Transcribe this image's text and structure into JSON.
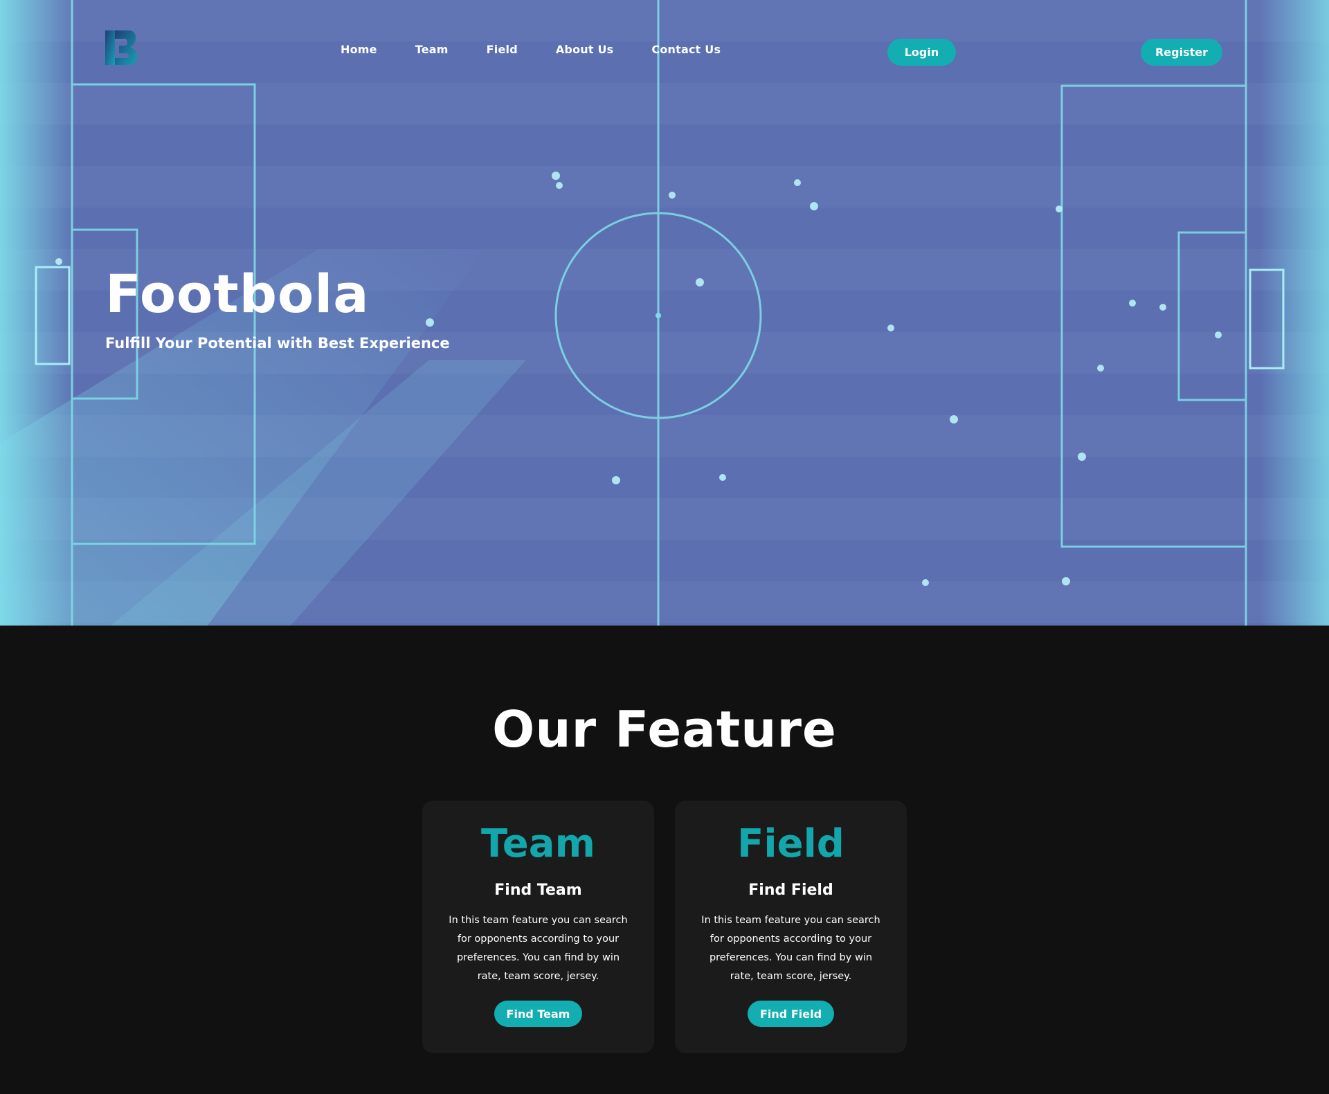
{
  "nav": {
    "items": [
      {
        "label": "Home"
      },
      {
        "label": "Team"
      },
      {
        "label": "Field"
      },
      {
        "label": "About Us"
      },
      {
        "label": "Contact Us"
      }
    ],
    "login_label": "Login",
    "register_label": "Register"
  },
  "hero": {
    "title": "Footbola",
    "subtitle": "Fulfill Your Potential with Best Experience"
  },
  "features": {
    "title": "Our Feature",
    "cards": [
      {
        "heading": "Team",
        "subheading": "Find Team",
        "description": "In this team feature you can search for opponents according to your preferences. You can find by win rate, team score, jersey.",
        "button_label": "Find Team"
      },
      {
        "heading": "Field",
        "subheading": "Find Field",
        "description": "In this team feature you can search for opponents according to your preferences. You can find by win rate, team score, jersey.",
        "button_label": "Find Field"
      }
    ]
  },
  "colors": {
    "accent": "#12aeb2",
    "card_heading": "#13a6ab",
    "hero_tint": "#5a73b1",
    "pitch_lines": "#7fd9e6",
    "page_background": "#111111",
    "card_background": "#1b1b1b"
  },
  "icons": {
    "logo": "footbola-logo-icon"
  }
}
